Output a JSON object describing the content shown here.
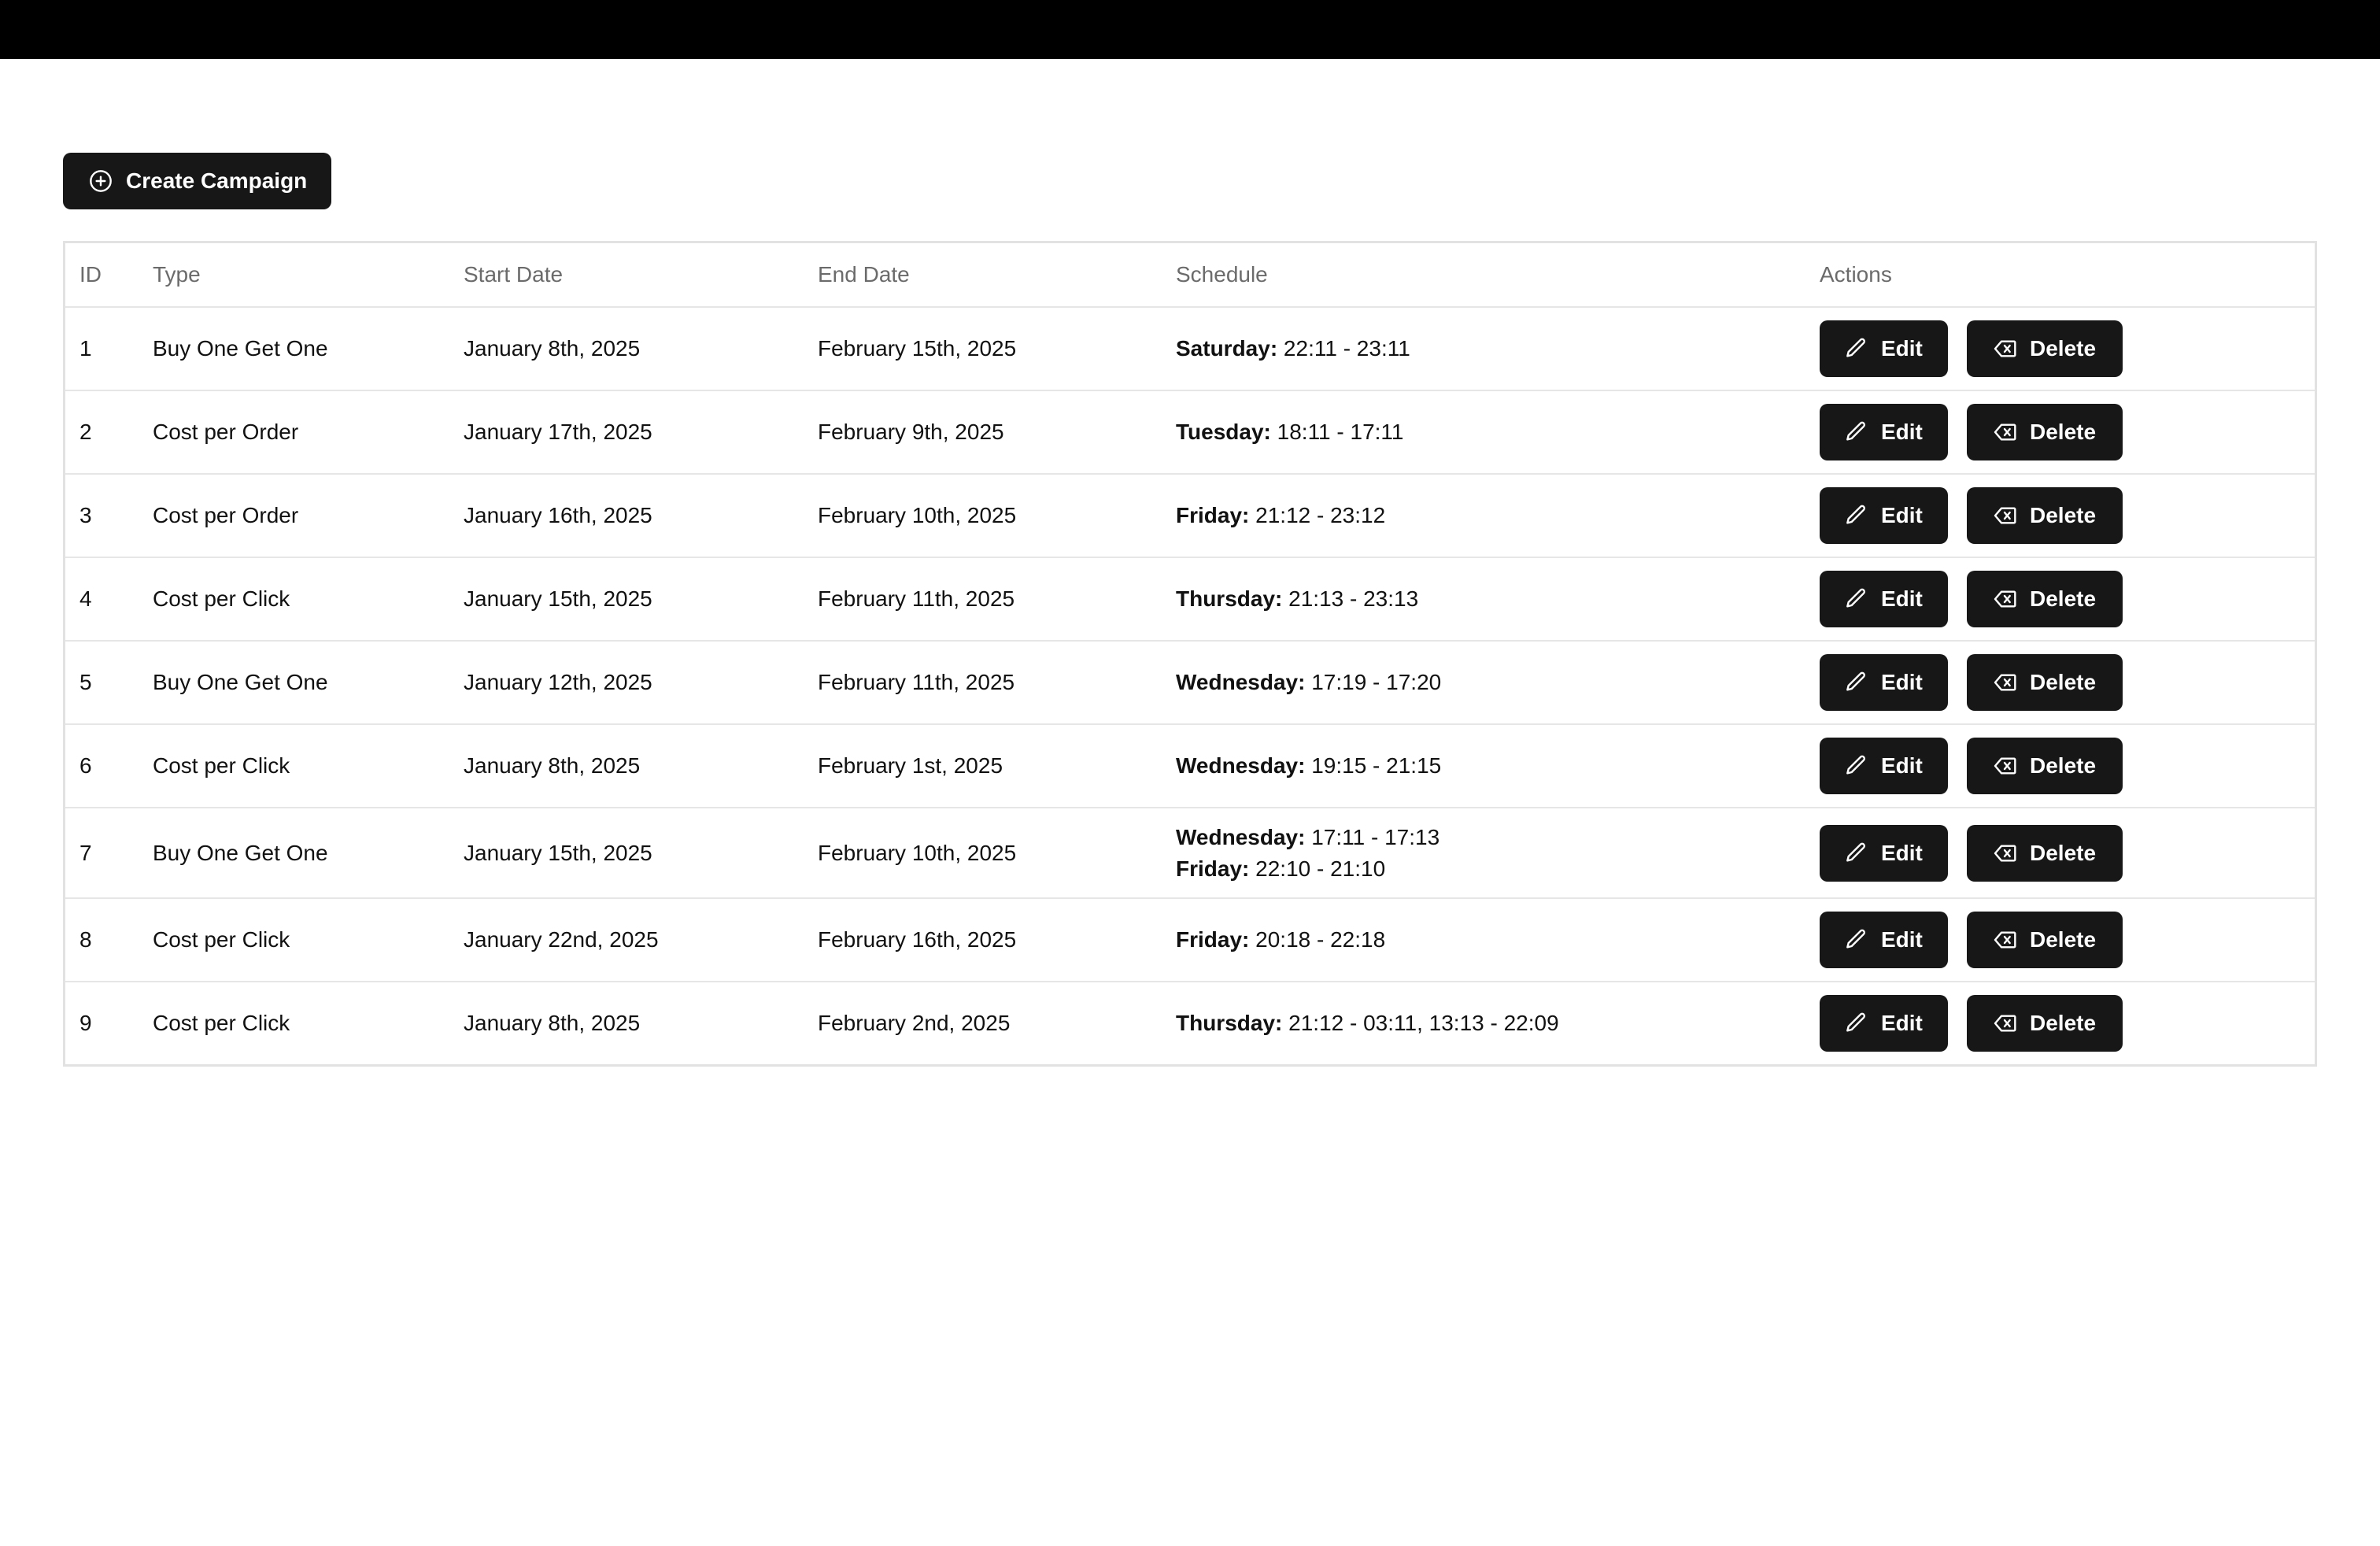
{
  "toolbar": {
    "create_label": "Create Campaign",
    "create_icon": "plus-circle-icon"
  },
  "table": {
    "headers": [
      "ID",
      "Type",
      "Start Date",
      "End Date",
      "Schedule",
      "Actions"
    ],
    "edit_label": "Edit",
    "edit_icon": "pencil-icon",
    "delete_label": "Delete",
    "delete_icon": "backspace-icon",
    "rows": [
      {
        "id": "1",
        "type": "Buy One Get One",
        "start": "January 8th, 2025",
        "end": "February 15th, 2025",
        "schedule": [
          {
            "day": "Saturday:",
            "times": " 22:11 - 23:11"
          }
        ]
      },
      {
        "id": "2",
        "type": "Cost per Order",
        "start": "January 17th, 2025",
        "end": "February 9th, 2025",
        "schedule": [
          {
            "day": "Tuesday:",
            "times": " 18:11 - 17:11"
          }
        ]
      },
      {
        "id": "3",
        "type": "Cost per Order",
        "start": "January 16th, 2025",
        "end": "February 10th, 2025",
        "schedule": [
          {
            "day": "Friday:",
            "times": " 21:12 - 23:12"
          }
        ]
      },
      {
        "id": "4",
        "type": "Cost per Click",
        "start": "January 15th, 2025",
        "end": "February 11th, 2025",
        "schedule": [
          {
            "day": "Thursday:",
            "times": " 21:13 - 23:13"
          }
        ]
      },
      {
        "id": "5",
        "type": "Buy One Get One",
        "start": "January 12th, 2025",
        "end": "February 11th, 2025",
        "schedule": [
          {
            "day": "Wednesday:",
            "times": " 17:19 - 17:20"
          }
        ]
      },
      {
        "id": "6",
        "type": "Cost per Click",
        "start": "January 8th, 2025",
        "end": "February 1st, 2025",
        "schedule": [
          {
            "day": "Wednesday:",
            "times": " 19:15 - 21:15"
          }
        ]
      },
      {
        "id": "7",
        "type": "Buy One Get One",
        "start": "January 15th, 2025",
        "end": "February 10th, 2025",
        "schedule": [
          {
            "day": "Wednesday:",
            "times": " 17:11 - 17:13"
          },
          {
            "day": "Friday:",
            "times": " 22:10 - 21:10"
          }
        ]
      },
      {
        "id": "8",
        "type": "Cost per Click",
        "start": "January 22nd, 2025",
        "end": "February 16th, 2025",
        "schedule": [
          {
            "day": "Friday:",
            "times": " 20:18 - 22:18"
          }
        ]
      },
      {
        "id": "9",
        "type": "Cost per Click",
        "start": "January 8th, 2025",
        "end": "February 2nd, 2025",
        "schedule": [
          {
            "day": "Thursday:",
            "times": " 21:12 - 03:11, 13:13 - 22:09"
          }
        ]
      }
    ]
  }
}
